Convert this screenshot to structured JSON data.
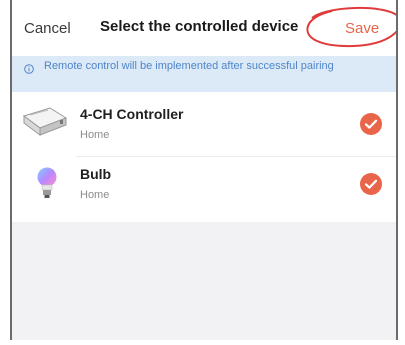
{
  "header": {
    "cancel_label": "Cancel",
    "title": "Select the controlled device",
    "save_label": "Save"
  },
  "banner": {
    "icon": "info-icon",
    "text": "Remote control will be implemented after successful pairing"
  },
  "devices": [
    {
      "name": "4-CH Controller",
      "room": "Home",
      "icon": "controller-icon",
      "selected": true
    },
    {
      "name": "Bulb",
      "room": "Home",
      "icon": "bulb-icon",
      "selected": true
    }
  ],
  "colors": {
    "accent": "#e8654a",
    "annotation": "#e03a3a",
    "banner_bg": "#dce9f7",
    "banner_text": "#4f86c9",
    "list_bg": "#ffffff",
    "screen_bg": "#f2f2f4"
  }
}
